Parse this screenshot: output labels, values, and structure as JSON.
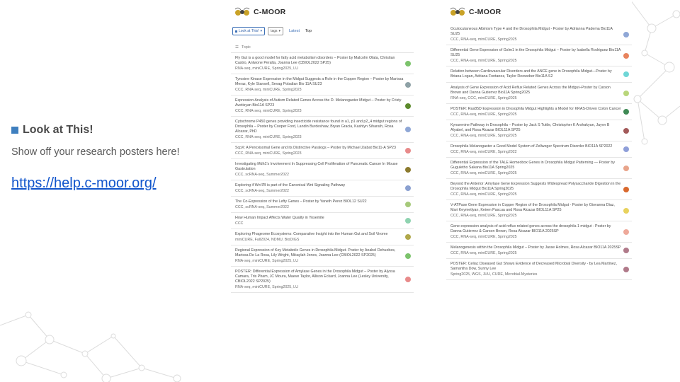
{
  "left_panel": {
    "heading": "Look at This!",
    "subtitle": "Show off your research posters here!",
    "link": "https://help.c-moor.org/"
  },
  "brand": "C-MOOR",
  "toolbar": {
    "category": "Look at This!",
    "tags": "tags",
    "latest": "Latest",
    "top": "Top",
    "topic_header": "Topic"
  },
  "topics_left": [
    {
      "title": "Fly Gut is a good model for fatty acid metabolism disorders – Poster by Malcolm Olata, Christian Castro, Antwone Peralta, Joanna Lee (CBIOL2022 SP25)",
      "tags": "RNA-seq, miniCURE, Spring2025, LU",
      "color": "#7cc36c"
    },
    {
      "title": "Tyrosine Kinase Expression in the Midgut Suggests a Role in the Copper Region – Poster by Marissa Meraz, Kyle Stansell, Sevag Poladian Bio 11A SU23",
      "tags": "CCC, RNA-seq, miniCURE, Spring2023",
      "color": "#8ea1a6"
    },
    {
      "title": "Expression Analysis of Autism Related Genes Across the D. Melanogaster Midgut – Poster by Cristy Avetisyan Bio11A SP23",
      "tags": "CCC, RNA-seq, miniCURE, Spring2023",
      "color": "#5c8a2c"
    },
    {
      "title": "Cytochrome P450 genes providing insecticide resistance found in a1, p1 and p2_4 midgut regions of Drosophila – Poster by Cooper Ford, Landin Burdeshaw, Bryan Gracia, Kashlyn Siharath, Rosa Alcazar, PhD",
      "tags": "CCC, RNA-seq, miniCURE, Spring2023",
      "color": "#8fa7d6"
    },
    {
      "title": "ScpX: A Peroxisomal Gene and its Distinctive Paralogs – Poster by Michael Ziabat Bio11-A SP23",
      "tags": "CCC, RNA-seq, miniCURE, Spring2023",
      "color": "#e88a8a"
    },
    {
      "title": "Investigating Mdh1's Involvement In Suppressing Cell Proliferation of Pancreatic Cancer In Mouse Gastrulation",
      "tags": "CCC, scRNA-seq, Summer2022",
      "color": "#8c7a2e"
    },
    {
      "title": "Exploring if Wnt7B is part of the Canonical Wnt Signaling Pathway",
      "tags": "CCC, scRNA-seq, Summer2022",
      "color": "#8aa0d0"
    },
    {
      "title": "The Co-Expression of the Lefty Genes – Poster by Yaneth Perez BIOL12 SU22",
      "tags": "CCC, scRNA-seq, Summer2022",
      "color": "#a6c97a"
    },
    {
      "title": "How Human Impact Affects Water Quality in Yosemite",
      "tags": "CCC",
      "color": "#8fd3b0"
    },
    {
      "title": "Exploring Phageome Ecosystems: Comparative Insight into the Human Gut and Soil Virome",
      "tags": "miniCURE, Fall2024, NDMU, BioDIGS",
      "color": "#b0a84a"
    },
    {
      "title": "Regional Expression of Key Metabolic Genes in Drosophila Midgut- Poster by Anabel Dehuebes, Marissa De La Rosa, Lily Wright, Mikaylah Jones, Joanna Lee (CBIOL2022 SP2025)",
      "tags": "RNA-seq, miniCURE, Spring2025, LU",
      "color": "#7cc36c"
    },
    {
      "title": "POSTER: Differential Expression of Amylase Genes in the Drosophila Midgut – Poster by Alyssa Camara, Tris Pham, JC Moura, Maeve Taylor, Allison Eckard, Joanna Lee (Lesley University, CBIOL2022 SP2025)",
      "tags": "RNA-seq, miniCURE, Spring2025, LU",
      "color": "#e88a8a"
    }
  ],
  "topics_right": [
    {
      "title": "Oculocutaneous Albinism Type 4 and the Drosophila Midgut - Poster by Adrianna Padema Bio11A SU25",
      "tags": "CCC, RNA-seq, miniCURE, Spring2025",
      "color": "#8fa7d6"
    },
    {
      "title": "Differential Gene Expression of Gslm1 in the Drosophila Midgut – Poster by Isabella Rodriguez Bio11A SU25",
      "tags": "CCC, RNA-seq, miniCURE, Spring2025",
      "color": "#e8845e"
    },
    {
      "title": "Relation between Cardiovascular Disorders and the ANCE gene in Drosophila Midgut—Poster by Briana Logan, Adriana Fontanez, Taylor Reeweber Bio11A S2",
      "tags": "",
      "color": "#6fd6d6"
    },
    {
      "title": "Analysis of Gene Expression of Acid Reflux Related Genes Across the Midgut–Poster by Carson Brown and Danna Gutierrez Bio11A Spring2025",
      "tags": "RNA-seq, CCC, miniCURE, Spring2025",
      "color": "#b9d67a"
    },
    {
      "title": "POSTER: Ras85D Expression in Drosophila Midgut Highlights a Model for KRAS-Driven Colon Cancer",
      "tags": "CCC, RNA-seq, miniCURE, Spring2025",
      "color": "#3f8a55"
    },
    {
      "title": "Kynurenine Pathway in Drosophila – Poster by Jack S Tuttle, Christopher K Arshakyan, Jayvn B Alyabel, and Rosa Alcazar BIOL11A SP25",
      "tags": "CCC, RNA-seq, miniCURE, Spring2025",
      "color": "#a35a5a"
    },
    {
      "title": "Drosophila Melanogaster a Good Model System of Zellweger Spectrum Disorder BIO11A SP2022",
      "tags": "CCC, RNA-seq, miniCURE, Spring2022",
      "color": "#8f9fd9"
    },
    {
      "title": "Differential Expression of the TALE Homeobox Genes in Drosophila Midgut Patterning — Poster by Guguletho Sakana Bio11A Spring2025",
      "tags": "CCC, RNA-seq, miniCURE, Spring2025",
      "color": "#e8a48a"
    },
    {
      "title": "Beyond the Anterior: Amylase Gene Expression Suggests Widespread Polysaccharide Digestion in the Drosophila Midgut Bio11A Spring2025",
      "tags": "CCC, RNA-seq, miniCURE, Spring2025",
      "color": "#d9692e"
    },
    {
      "title": "V-ATPase Gene Expression in Copper Region of the Drosophila Midgut - Poster by Giovanna Diaz, Mari Keymetlyan, Keiren Pascua and Rosa Alcazar BIOL11A SP25",
      "tags": "CCC, RNA-seq, miniCURE, Spring2025",
      "color": "#e8d25e"
    },
    {
      "title": "Gene expression analysis of acid reflux related genes across the drosophila 1 midgut - Poster by Danna Gutierrez & Carson Brown, Rosa Alcazar BIO11A 2025SP",
      "tags": "CCC, RNA-seq, miniCURE, Spring2025",
      "color": "#eea99a"
    },
    {
      "title": "Melanogenesis within the Drosophila Midgut – Poster by Jasse Holmes, Rosa Alcazar BIO11A 2025SP",
      "tags": "CCC, RNA-seq, miniCURE, Spring2025",
      "color": "#b07a8a"
    },
    {
      "title": "POSTER: Celiac Diseased Gut Shows Evidence of Decreased Microbial Diversity - by Lea Martinez, Samantha Dow, Sunny Lee",
      "tags": "Spring2025, WGS, JHU, CURE, Microbial-Mysteries",
      "color": "#b07a8a"
    }
  ]
}
